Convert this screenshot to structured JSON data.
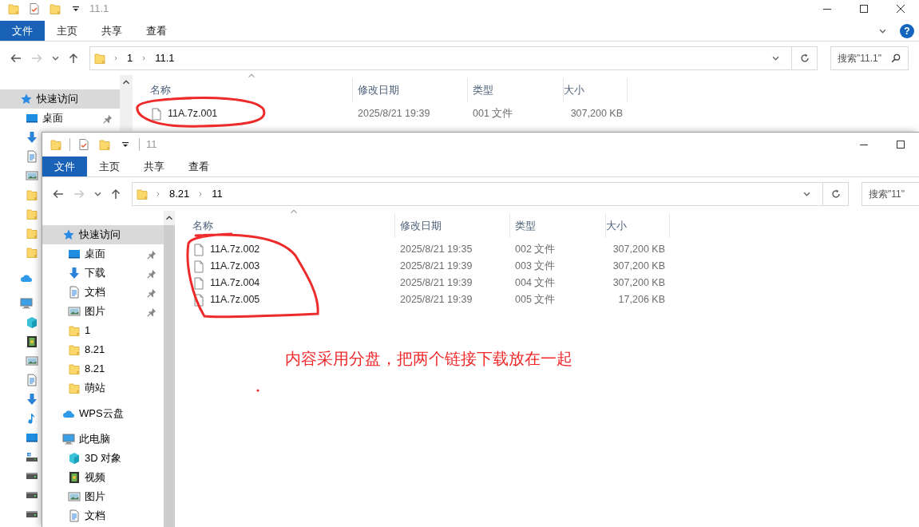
{
  "windows": [
    {
      "title": "11.1",
      "quick_toolbar": [
        {
          "kind": "folder"
        },
        {
          "kind": "properties"
        },
        {
          "kind": "folder"
        },
        {
          "kind": "caret"
        }
      ],
      "caption_buttons": [
        {
          "kind": "minimize"
        },
        {
          "kind": "maximize"
        },
        {
          "kind": "close"
        }
      ],
      "ribbon_tabs": [
        {
          "label": "文件",
          "selected": true
        },
        {
          "label": "主页",
          "selected": false
        },
        {
          "label": "共享",
          "selected": false
        },
        {
          "label": "查看",
          "selected": false
        }
      ],
      "help": "?",
      "breadcrumb": [
        "1",
        "11.1"
      ],
      "search": {
        "placeholder": "搜索\"11.1\""
      },
      "sidebar": [
        {
          "label": "快速访问",
          "kind": "star",
          "selected": true,
          "children": [
            {
              "label": "桌面",
              "kind": "desktop",
              "pinned": true,
              "selected": false
            },
            {
              "kind": "download",
              "selected": false
            },
            {
              "kind": "document",
              "selected": false
            },
            {
              "kind": "picture",
              "selected": false
            },
            {
              "kind": "folder",
              "selected": false
            },
            {
              "kind": "folder",
              "selected": false
            },
            {
              "kind": "folder",
              "selected": false
            },
            {
              "kind": "folder",
              "selected": false
            }
          ]
        },
        {
          "kind": "cloud",
          "selected": false
        },
        {
          "kind": "computer",
          "selected": false,
          "children": [
            {
              "kind": "cube",
              "selected": false
            },
            {
              "kind": "video",
              "selected": false
            },
            {
              "kind": "picture",
              "selected": false
            },
            {
              "kind": "document",
              "selected": false
            },
            {
              "kind": "download",
              "selected": false
            },
            {
              "kind": "music",
              "selected": false
            },
            {
              "kind": "desktop",
              "selected": false
            },
            {
              "kind": "system-drive",
              "selected": false
            },
            {
              "kind": "drive",
              "selected": false
            },
            {
              "kind": "drive",
              "selected": false
            },
            {
              "kind": "drive",
              "selected": false
            }
          ]
        }
      ],
      "columns": [
        "名称",
        "修改日期",
        "类型",
        "大小"
      ],
      "files": [
        {
          "name": "11A.7z.001",
          "modified": "2025/8/21 19:39",
          "type": "001 文件",
          "size": "307,200 KB"
        }
      ]
    },
    {
      "title": "11",
      "quick_toolbar": [
        {
          "kind": "folder"
        },
        {
          "kind": "separator"
        },
        {
          "kind": "properties"
        },
        {
          "kind": "folder"
        },
        {
          "kind": "caret"
        },
        {
          "kind": "separator"
        }
      ],
      "caption_buttons": [
        {
          "kind": "minimize"
        },
        {
          "kind": "maximize"
        }
      ],
      "ribbon_tabs": [
        {
          "label": "文件",
          "selected": true
        },
        {
          "label": "主页",
          "selected": false
        },
        {
          "label": "共享",
          "selected": false
        },
        {
          "label": "查看",
          "selected": false
        }
      ],
      "breadcrumb": [
        "8.21",
        "11"
      ],
      "search": {
        "placeholder": "搜索\"11\""
      },
      "sidebar": [
        {
          "label": "快速访问",
          "kind": "star",
          "selected": true,
          "children": [
            {
              "label": "桌面",
              "kind": "desktop",
              "pinned": true,
              "selected": false
            },
            {
              "label": "下载",
              "kind": "download",
              "pinned": true,
              "selected": false
            },
            {
              "label": "文档",
              "kind": "document",
              "pinned": true,
              "selected": false
            },
            {
              "label": "图片",
              "kind": "picture",
              "pinned": true,
              "selected": false
            },
            {
              "label": "1",
              "kind": "folder",
              "pinned": false,
              "selected": false
            },
            {
              "label": "8.21",
              "kind": "folder",
              "pinned": false,
              "selected": false
            },
            {
              "label": "8.21",
              "kind": "folder",
              "pinned": false,
              "selected": false
            },
            {
              "label": "萌站",
              "kind": "folder",
              "pinned": false,
              "selected": false
            }
          ]
        },
        {
          "label": "WPS云盘",
          "kind": "cloud",
          "selected": false
        },
        {
          "label": "此电脑",
          "kind": "computer",
          "selected": false,
          "children": [
            {
              "label": "3D 对象",
              "kind": "cube",
              "selected": false
            },
            {
              "label": "视频",
              "kind": "video",
              "selected": false
            },
            {
              "label": "图片",
              "kind": "picture",
              "selected": false
            },
            {
              "label": "文档",
              "kind": "document",
              "selected": false
            }
          ]
        }
      ],
      "columns": [
        "名称",
        "修改日期",
        "类型",
        "大小"
      ],
      "files": [
        {
          "name": "11A.7z.002",
          "modified": "2025/8/21 19:35",
          "type": "002 文件",
          "size": "307,200 KB"
        },
        {
          "name": "11A.7z.003",
          "modified": "2025/8/21 19:39",
          "type": "003 文件",
          "size": "307,200 KB"
        },
        {
          "name": "11A.7z.004",
          "modified": "2025/8/21 19:39",
          "type": "004 文件",
          "size": "307,200 KB"
        },
        {
          "name": "11A.7z.005",
          "modified": "2025/8/21 19:39",
          "type": "005 文件",
          "size": "17,206 KB"
        }
      ]
    }
  ],
  "annotation": {
    "note": "内容采用分盘，把两个链接下载放在一起"
  }
}
